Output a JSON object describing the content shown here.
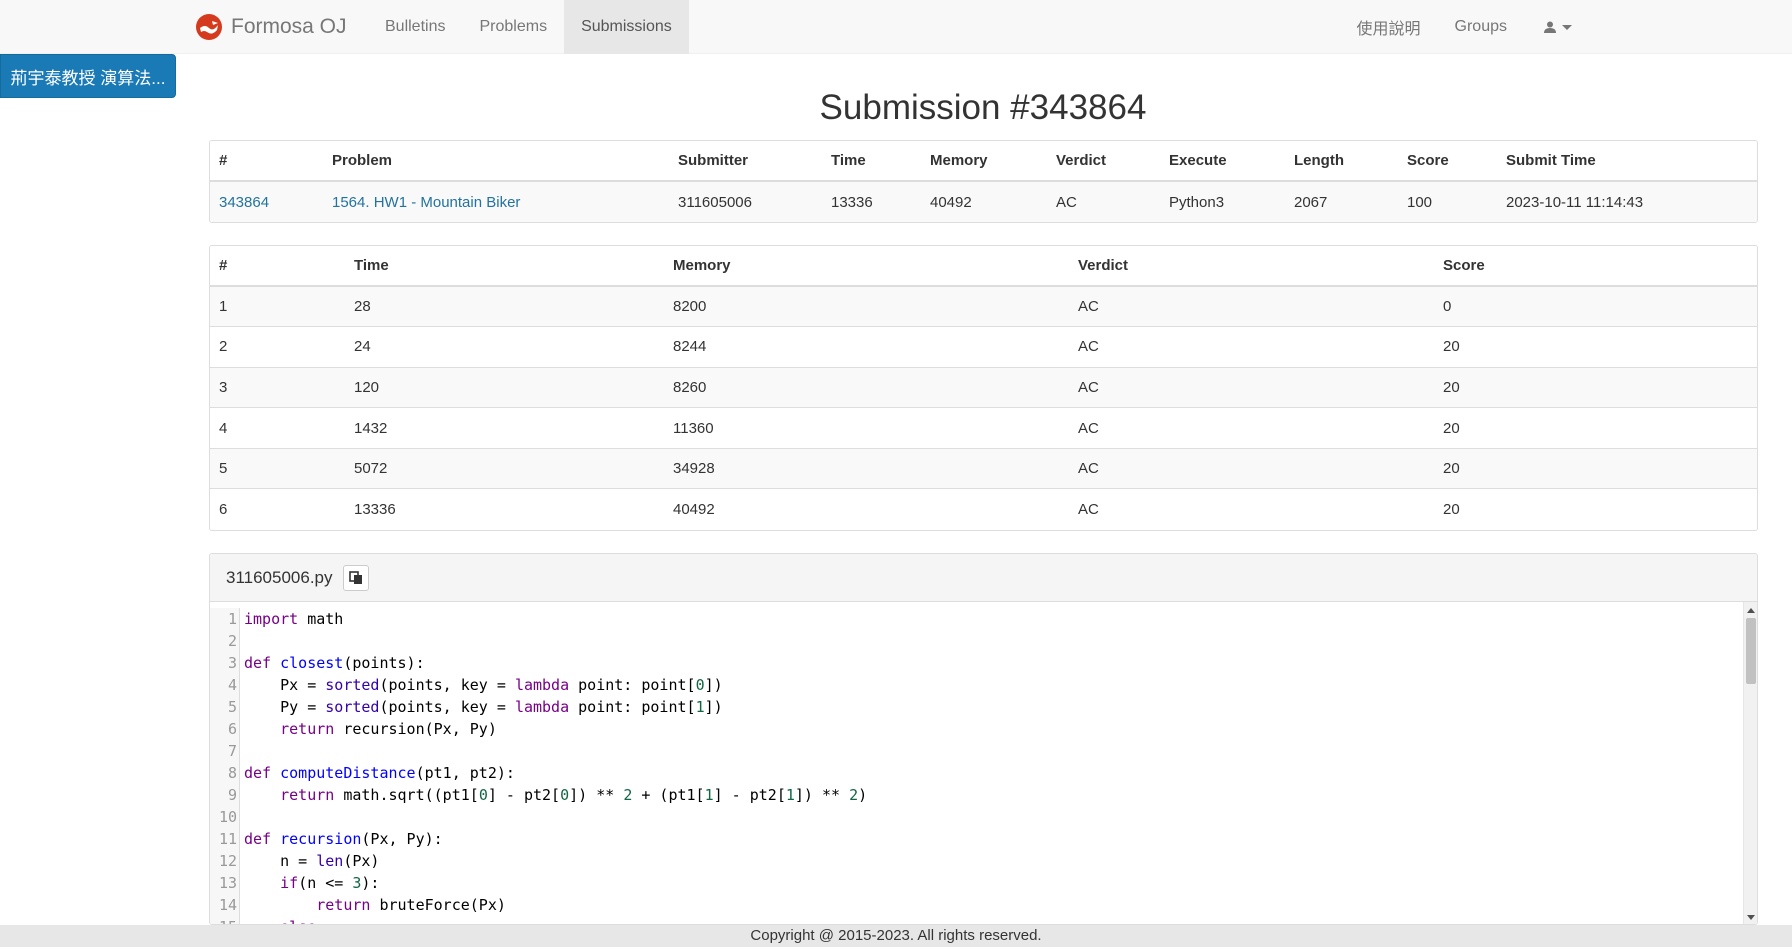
{
  "brand": {
    "name": "Formosa OJ"
  },
  "nav": {
    "left": [
      "Bulletins",
      "Problems",
      "Submissions"
    ],
    "right": [
      "使用說明",
      "Groups"
    ]
  },
  "course_button": "荊宇泰教授 演算法...",
  "title": "Submission #343864",
  "summary": {
    "headers": [
      "#",
      "Problem",
      "Submitter",
      "Time",
      "Memory",
      "Verdict",
      "Execute",
      "Length",
      "Score",
      "Submit Time"
    ],
    "row": {
      "id": "343864",
      "problem": "1564. HW1 - Mountain Biker",
      "submitter": "311605006",
      "time": "13336",
      "memory": "40492",
      "verdict": "AC",
      "execute": "Python3",
      "length": "2067",
      "score": "100",
      "submit_time": "2023-10-11 11:14:43"
    }
  },
  "tests": {
    "headers": [
      "#",
      "Time",
      "Memory",
      "Verdict",
      "Score"
    ],
    "rows": [
      [
        "1",
        "28",
        "8200",
        "AC",
        "0"
      ],
      [
        "2",
        "24",
        "8244",
        "AC",
        "20"
      ],
      [
        "3",
        "120",
        "8260",
        "AC",
        "20"
      ],
      [
        "4",
        "1432",
        "11360",
        "AC",
        "20"
      ],
      [
        "5",
        "5072",
        "34928",
        "AC",
        "20"
      ],
      [
        "6",
        "13336",
        "40492",
        "AC",
        "20"
      ]
    ]
  },
  "code": {
    "filename": "311605006.py",
    "lines": [
      "import math",
      "",
      "def closest(points):",
      "    Px = sorted(points, key = lambda point: point[0])",
      "    Py = sorted(points, key = lambda point: point[1])",
      "    return recursion(Px, Py)",
      "",
      "def computeDistance(pt1, pt2):",
      "    return math.sqrt((pt1[0] - pt2[0]) ** 2 + (pt1[1] - pt2[1]) ** 2)",
      "",
      "def recursion(Px, Py):",
      "    n = len(Px)",
      "    if(n <= 3):",
      "        return bruteForce(Px)",
      "    else:"
    ]
  },
  "footer": "Copyright @ 2015-2023. All rights reserved.",
  "colors": {
    "accent": "#1a7ab5",
    "link": "#23739e",
    "navbar_bg": "#f8f8f8",
    "logo": "#d63a1e"
  }
}
